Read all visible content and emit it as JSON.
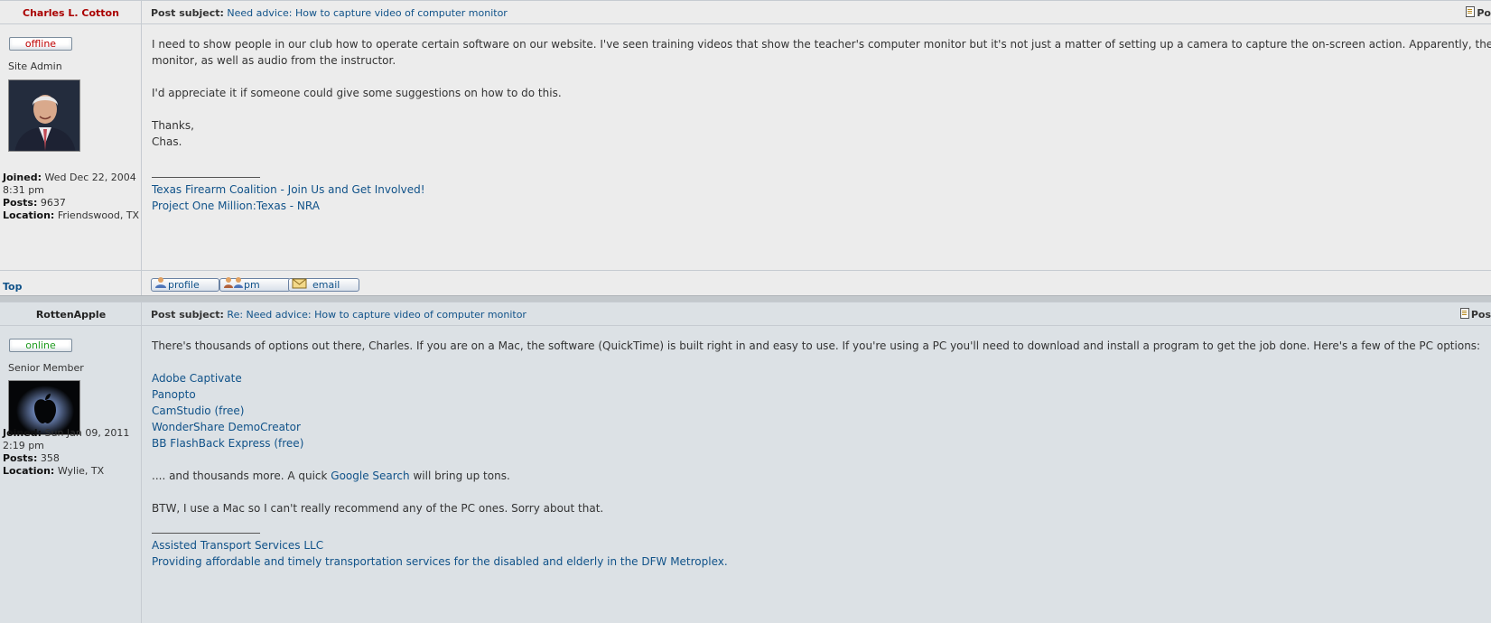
{
  "posts": [
    {
      "author": "Charles L. Cotton",
      "subject_label": "Post subject:",
      "subject": "Need advice: How to capture video of computer monitor",
      "post_button": "Po",
      "status": "offline",
      "rank": "Site Admin",
      "joined_label": "Joined:",
      "joined": "Wed Dec 22, 2004",
      "joined_time": "8:31 pm",
      "posts_label": "Posts:",
      "posts": "9637",
      "location_label": "Location:",
      "location": "Friendswood, TX",
      "body": {
        "p1_line1": "I need to show people in our club how to operate certain software on our website. I've seen training videos that show the teacher's computer monitor but it's not just a matter of setting up a camera to capture the on-screen action. Apparently, there's a",
        "p1_line2": "monitor, as well as audio from the instructor.",
        "p2": "I'd appreciate it if someone could give some suggestions on how to do this.",
        "p3_line1": "Thanks,",
        "p3_line2": "Chas."
      },
      "signature": [
        "Texas Firearm Coalition - Join Us and Get Involved!",
        "Project One Million:Texas - NRA"
      ],
      "top_link": "Top",
      "buttons": {
        "profile": "profile",
        "pm": "pm",
        "email": "email"
      }
    },
    {
      "author": "RottenApple",
      "subject_label": "Post subject:",
      "subject": "Re: Need advice: How to capture video of computer monitor",
      "post_button": "Pos",
      "status": "online",
      "rank": "Senior Member",
      "joined_label": "Joined:",
      "joined": "Sun Jan 09, 2011",
      "joined_time": "2:19 pm",
      "posts_label": "Posts:",
      "posts": "358",
      "location_label": "Location:",
      "location": "Wylie, TX",
      "body": {
        "intro": "There's thousands of options out there, Charles. If you are on a Mac, the software (QuickTime) is built right in and easy to use. If you're using a PC you'll need to download and install a program to get the job done. Here's a few of the PC options:",
        "links": [
          "Adobe Captivate",
          "Panopto",
          "CamStudio (free)",
          "WonderShare DemoCreator",
          "BB FlashBack Express (free)"
        ],
        "more_prefix": ".... and thousands more. A quick ",
        "more_link": "Google Search",
        "more_suffix": " will bring up tons.",
        "btw": "BTW, I use a Mac so I can't really recommend any of the PC ones. Sorry about that."
      },
      "signature": [
        "Assisted Transport Services LLC",
        "Providing affordable and timely transportation services for the disabled and elderly in the DFW Metroplex."
      ]
    }
  ],
  "colors": {
    "link": "#105289",
    "offline": "#c00000",
    "online": "#1e9b1e",
    "author_admin": "#aa0000"
  }
}
